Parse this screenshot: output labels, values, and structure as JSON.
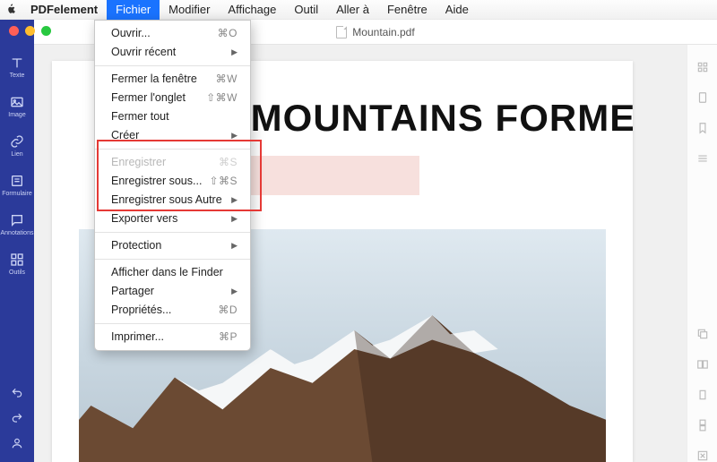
{
  "menubar": {
    "app": "PDFelement",
    "items": [
      "Fichier",
      "Modifier",
      "Affichage",
      "Outil",
      "Aller à",
      "Fenêtre",
      "Aide"
    ],
    "active": "Fichier"
  },
  "window": {
    "filename": "Mountain.pdf"
  },
  "sidebar": {
    "items": [
      {
        "label": "Texte",
        "icon": "text"
      },
      {
        "label": "Image",
        "icon": "image"
      },
      {
        "label": "Lien",
        "icon": "link"
      },
      {
        "label": "Formulaire",
        "icon": "form"
      },
      {
        "label": "Annotations",
        "icon": "annot"
      },
      {
        "label": "Outils",
        "icon": "tools"
      }
    ]
  },
  "document": {
    "headline": "E MOUNTAINS FORMED?"
  },
  "dropdown": {
    "groups": [
      [
        {
          "label": "Ouvrir...",
          "shortcut": "⌘O"
        },
        {
          "label": "Ouvrir récent",
          "submenu": true
        }
      ],
      [
        {
          "label": "Fermer la fenêtre",
          "shortcut": "⌘W"
        },
        {
          "label": "Fermer l'onglet",
          "shortcut": "⇧⌘W"
        },
        {
          "label": "Fermer tout"
        },
        {
          "label": "Créer",
          "submenu": true
        }
      ],
      [
        {
          "label": "Enregistrer",
          "shortcut": "⌘S",
          "disabled": true
        },
        {
          "label": "Enregistrer sous...",
          "shortcut": "⇧⌘S"
        },
        {
          "label": "Enregistrer sous Autre",
          "submenu": true
        },
        {
          "label": "Exporter vers",
          "submenu": true
        }
      ],
      [
        {
          "label": "Protection",
          "submenu": true
        }
      ],
      [
        {
          "label": "Afficher dans le Finder"
        },
        {
          "label": "Partager",
          "submenu": true
        },
        {
          "label": "Propriétés...",
          "shortcut": "⌘D"
        }
      ],
      [
        {
          "label": "Imprimer...",
          "shortcut": "⌘P"
        }
      ]
    ],
    "highlight_group": 2
  }
}
